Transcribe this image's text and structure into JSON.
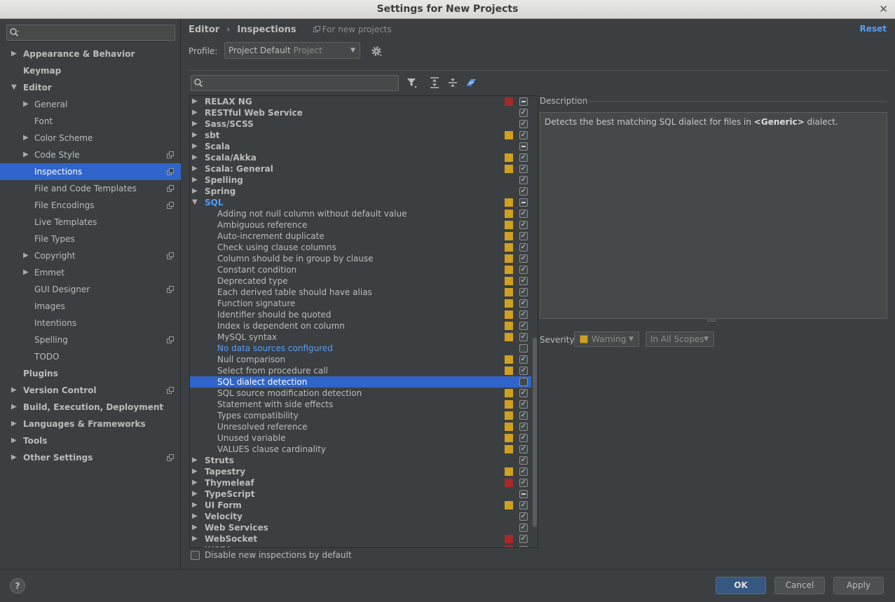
{
  "window": {
    "title": "Settings for New Projects",
    "close_glyph": "✕"
  },
  "sidebar": {
    "search_placeholder": "",
    "items": [
      {
        "label": "Appearance & Behavior",
        "level": 0,
        "bold": true,
        "arrow": "▶",
        "scope": false
      },
      {
        "label": "Keymap",
        "level": 0,
        "bold": true,
        "arrow": "",
        "scope": false
      },
      {
        "label": "Editor",
        "level": 0,
        "bold": true,
        "arrow": "▼",
        "scope": false
      },
      {
        "label": "General",
        "level": 1,
        "bold": false,
        "arrow": "▶",
        "scope": false
      },
      {
        "label": "Font",
        "level": 1,
        "bold": false,
        "arrow": "",
        "scope": false
      },
      {
        "label": "Color Scheme",
        "level": 1,
        "bold": false,
        "arrow": "▶",
        "scope": false
      },
      {
        "label": "Code Style",
        "level": 1,
        "bold": false,
        "arrow": "▶",
        "scope": true
      },
      {
        "label": "Inspections",
        "level": 1,
        "bold": false,
        "arrow": "",
        "scope": true,
        "selected": true
      },
      {
        "label": "File and Code Templates",
        "level": 1,
        "bold": false,
        "arrow": "",
        "scope": true
      },
      {
        "label": "File Encodings",
        "level": 1,
        "bold": false,
        "arrow": "",
        "scope": true
      },
      {
        "label": "Live Templates",
        "level": 1,
        "bold": false,
        "arrow": "",
        "scope": false
      },
      {
        "label": "File Types",
        "level": 1,
        "bold": false,
        "arrow": "",
        "scope": false
      },
      {
        "label": "Copyright",
        "level": 1,
        "bold": false,
        "arrow": "▶",
        "scope": true
      },
      {
        "label": "Emmet",
        "level": 1,
        "bold": false,
        "arrow": "▶",
        "scope": false
      },
      {
        "label": "GUI Designer",
        "level": 1,
        "bold": false,
        "arrow": "",
        "scope": true
      },
      {
        "label": "Images",
        "level": 1,
        "bold": false,
        "arrow": "",
        "scope": false
      },
      {
        "label": "Intentions",
        "level": 1,
        "bold": false,
        "arrow": "",
        "scope": false
      },
      {
        "label": "Spelling",
        "level": 1,
        "bold": false,
        "arrow": "",
        "scope": true
      },
      {
        "label": "TODO",
        "level": 1,
        "bold": false,
        "arrow": "",
        "scope": false
      },
      {
        "label": "Plugins",
        "level": 0,
        "bold": true,
        "arrow": "",
        "scope": false
      },
      {
        "label": "Version Control",
        "level": 0,
        "bold": true,
        "arrow": "▶",
        "scope": true
      },
      {
        "label": "Build, Execution, Deployment",
        "level": 0,
        "bold": true,
        "arrow": "▶",
        "scope": false
      },
      {
        "label": "Languages & Frameworks",
        "level": 0,
        "bold": true,
        "arrow": "▶",
        "scope": false
      },
      {
        "label": "Tools",
        "level": 0,
        "bold": true,
        "arrow": "▶",
        "scope": false
      },
      {
        "label": "Other Settings",
        "level": 0,
        "bold": true,
        "arrow": "▶",
        "scope": true
      }
    ]
  },
  "header": {
    "crumb1": "Editor",
    "crumb_sep": "›",
    "crumb2": "Inspections",
    "note": "For new projects",
    "reset": "Reset"
  },
  "profile": {
    "label": "Profile:",
    "name": "Project Default",
    "kind": "Project"
  },
  "inspections": {
    "search_placeholder": "",
    "rows": [
      {
        "label": "RELAX NG",
        "type": "group",
        "sev": "error",
        "chk": "dash"
      },
      {
        "label": "RESTful Web Service",
        "type": "group",
        "sev": "",
        "chk": "on"
      },
      {
        "label": "Sass/SCSS",
        "type": "group",
        "sev": "",
        "chk": "on"
      },
      {
        "label": "sbt",
        "type": "group",
        "sev": "warning",
        "chk": "on"
      },
      {
        "label": "Scala",
        "type": "group",
        "sev": "",
        "chk": "dash"
      },
      {
        "label": "Scala/Akka",
        "type": "group",
        "sev": "warning",
        "chk": "on"
      },
      {
        "label": "Scala: General",
        "type": "group",
        "sev": "warning",
        "chk": "on"
      },
      {
        "label": "Spelling",
        "type": "group",
        "sev": "",
        "chk": "on"
      },
      {
        "label": "Spring",
        "type": "group",
        "sev": "",
        "chk": "on"
      },
      {
        "label": "SQL",
        "type": "group-open",
        "sev": "warning",
        "chk": "dash",
        "blue": true
      },
      {
        "label": "Adding not null column without default value",
        "type": "child",
        "sev": "warning",
        "chk": "on"
      },
      {
        "label": "Ambiguous reference",
        "type": "child",
        "sev": "warning",
        "chk": "on"
      },
      {
        "label": "Auto-increment duplicate",
        "type": "child",
        "sev": "warning",
        "chk": "on"
      },
      {
        "label": "Check using clause columns",
        "type": "child",
        "sev": "warning",
        "chk": "on"
      },
      {
        "label": "Column should be in group by clause",
        "type": "child",
        "sev": "warning",
        "chk": "on"
      },
      {
        "label": "Constant condition",
        "type": "child",
        "sev": "warning",
        "chk": "on"
      },
      {
        "label": "Deprecated type",
        "type": "child",
        "sev": "warning",
        "chk": "on"
      },
      {
        "label": "Each derived table should have alias",
        "type": "child",
        "sev": "warning",
        "chk": "on"
      },
      {
        "label": "Function signature",
        "type": "child",
        "sev": "warning",
        "chk": "on"
      },
      {
        "label": "Identifier should be quoted",
        "type": "child",
        "sev": "warning",
        "chk": "on"
      },
      {
        "label": "Index is dependent on column",
        "type": "child",
        "sev": "warning",
        "chk": "on"
      },
      {
        "label": "MySQL syntax",
        "type": "child",
        "sev": "warning",
        "chk": "on"
      },
      {
        "label": "No data sources configured",
        "type": "child",
        "sev": "",
        "chk": "off",
        "link": true
      },
      {
        "label": "Null comparison",
        "type": "child",
        "sev": "warning",
        "chk": "on"
      },
      {
        "label": "Select from procedure call",
        "type": "child",
        "sev": "warning",
        "chk": "on"
      },
      {
        "label": "SQL dialect detection",
        "type": "child",
        "sev": "",
        "chk": "off",
        "selected": true
      },
      {
        "label": "SQL source modification detection",
        "type": "child",
        "sev": "warning",
        "chk": "on"
      },
      {
        "label": "Statement with side effects",
        "type": "child",
        "sev": "warning",
        "chk": "on"
      },
      {
        "label": "Types compatibility",
        "type": "child",
        "sev": "warning",
        "chk": "on"
      },
      {
        "label": "Unresolved reference",
        "type": "child",
        "sev": "warning",
        "chk": "on"
      },
      {
        "label": "Unused variable",
        "type": "child",
        "sev": "warning",
        "chk": "on"
      },
      {
        "label": "VALUES clause cardinality",
        "type": "child",
        "sev": "warning",
        "chk": "on"
      },
      {
        "label": "Struts",
        "type": "group",
        "sev": "",
        "chk": "on"
      },
      {
        "label": "Tapestry",
        "type": "group",
        "sev": "warning",
        "chk": "on"
      },
      {
        "label": "Thymeleaf",
        "type": "group",
        "sev": "error",
        "chk": "on"
      },
      {
        "label": "TypeScript",
        "type": "group",
        "sev": "",
        "chk": "dash"
      },
      {
        "label": "UI Form",
        "type": "group",
        "sev": "warning",
        "chk": "on"
      },
      {
        "label": "Velocity",
        "type": "group",
        "sev": "",
        "chk": "on"
      },
      {
        "label": "Web Services",
        "type": "group",
        "sev": "",
        "chk": "on"
      },
      {
        "label": "WebSocket",
        "type": "group",
        "sev": "error",
        "chk": "on"
      },
      {
        "label": "WSDL",
        "type": "group",
        "sev": "error",
        "chk": "on"
      }
    ],
    "disable_label": "Disable new inspections by default"
  },
  "description": {
    "title": "Description",
    "text_before": "Detects the best matching SQL dialect for files in ",
    "text_bold": "<Generic>",
    "text_after": " dialect."
  },
  "severity": {
    "label": "Severity:",
    "value": "Warning",
    "scope": "In All Scopes"
  },
  "footer": {
    "help": "?",
    "ok": "OK",
    "cancel": "Cancel",
    "apply": "Apply"
  },
  "colors": {
    "selection": "#2f65ca",
    "warning": "#d0a020",
    "error": "#a52a2a",
    "link": "#589df6",
    "background": "#3c3f41"
  },
  "icons": {
    "search": "magnifier-icon",
    "filter": "filter-icon",
    "expand": "expand-all-icon",
    "collapse": "collapse-all-icon",
    "reset_to_empty": "eraser-icon",
    "gear": "gear-icon",
    "scope": "project-scope-icon"
  }
}
